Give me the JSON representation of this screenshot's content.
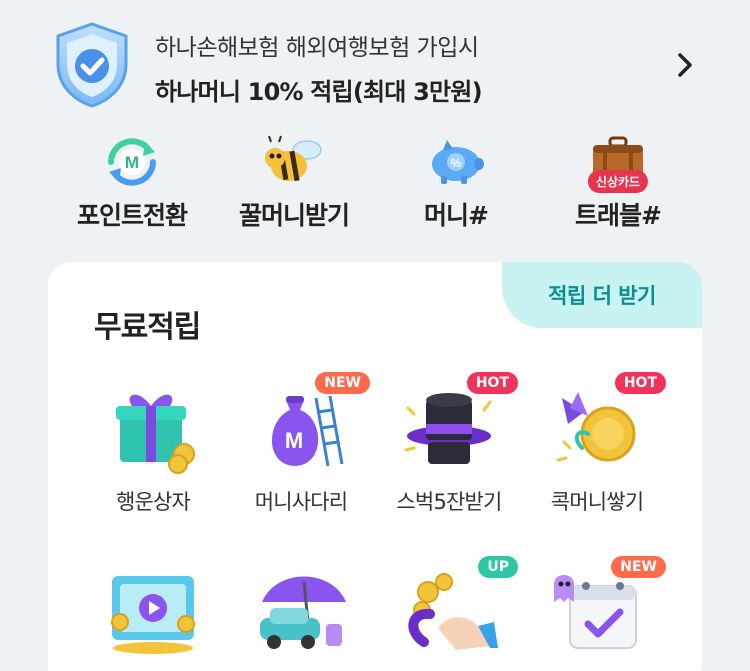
{
  "banner": {
    "line1": "하나손해보험 해외여행보험 가입시",
    "line2": "하나머니 10% 적립(최대 3만원)"
  },
  "quick_menu": [
    {
      "label": "포인트전환",
      "icon": "point-exchange-icon"
    },
    {
      "label": "꿀머니받기",
      "icon": "bee-icon"
    },
    {
      "label": "머니#",
      "icon": "piggy-bank-icon"
    },
    {
      "label": "트래블#",
      "icon": "suitcase-icon",
      "badge": "신상카드"
    }
  ],
  "free_reward": {
    "title": "무료적립",
    "more_label": "적립 더 받기",
    "items": [
      {
        "label": "행운상자",
        "icon": "gift-box-icon"
      },
      {
        "label": "머니사다리",
        "icon": "money-bag-ladder-icon",
        "tag": "NEW"
      },
      {
        "label": "스벅5잔받기",
        "icon": "magic-hat-icon",
        "tag": "HOT"
      },
      {
        "label": "콕머니쌓기",
        "icon": "coin-pinwheel-icon",
        "tag": "HOT"
      },
      {
        "label": "",
        "icon": "video-play-icon"
      },
      {
        "label": "",
        "icon": "car-umbrella-icon"
      },
      {
        "label": "",
        "icon": "hand-coins-icon",
        "tag": "UP"
      },
      {
        "label": "",
        "icon": "calendar-check-icon",
        "tag": "NEW"
      }
    ]
  },
  "colors": {
    "background": "#eef2f5",
    "accent_teal": "#0a8f8f",
    "tag_new": "#ff6a4d",
    "tag_hot": "#f0335a",
    "tag_up": "#2ec7a4",
    "badge_red": "#e8344e"
  }
}
